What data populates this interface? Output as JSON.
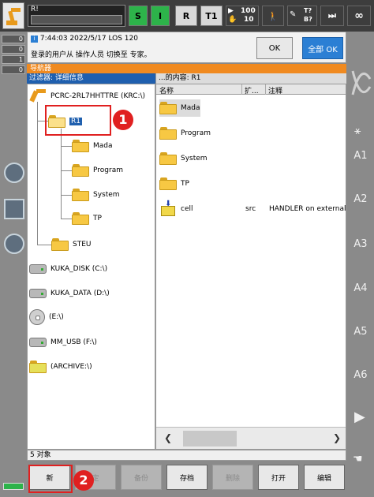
{
  "topbar": {
    "program_name": "R!",
    "status_s": "S",
    "status_i": "I",
    "status_r": "R",
    "mode": "T1",
    "override_top": "100",
    "override_bottom": "10",
    "tool_top": "T?",
    "tool_bottom": "B?",
    "infinity": "∞"
  },
  "leftstrip": {
    "counters": [
      "0",
      "0",
      "1",
      "0"
    ]
  },
  "message": {
    "line1": "7:44:03 2022/5/17 LOS 120",
    "line2": "登录的用户从 操作人员 切换至 专家。",
    "ok_label": "OK",
    "all_ok_label": "全部 OK"
  },
  "navigator": {
    "title": "导航器",
    "filter_label": "过滤器: 详细信息",
    "content_label": "...的内容: R1",
    "tree": {
      "root": "PCRC-2RL7HHTTRE (KRC:\\)",
      "r1": "R1",
      "children": [
        "Mada",
        "Program",
        "System",
        "TP"
      ],
      "steu": "STEU",
      "drives": [
        "KUKA_DISK (C:\\)",
        "KUKA_DATA (D:\\)",
        "(E:\\)",
        "MM_USB (F:\\)",
        "(ARCHIVE:\\)"
      ]
    },
    "list": {
      "headers": {
        "name": "名称",
        "ext": "扩...",
        "comment": "注释"
      },
      "items": [
        {
          "name": "Mada",
          "ext": "",
          "comment": ""
        },
        {
          "name": "Program",
          "ext": "",
          "comment": ""
        },
        {
          "name": "System",
          "ext": "",
          "comment": ""
        },
        {
          "name": "TP",
          "ext": "",
          "comment": ""
        },
        {
          "name": "cell",
          "ext": "src",
          "comment": "HANDLER on external ..."
        }
      ]
    },
    "status": "5 对象"
  },
  "softkeys": [
    "新",
    "定",
    "备份",
    "存档",
    "删除",
    "打开",
    "编辑"
  ],
  "rightstrip": {
    "axes": [
      "A1",
      "A2",
      "A3",
      "A4",
      "A5",
      "A6"
    ]
  },
  "annotations": {
    "one": "1",
    "two": "2"
  },
  "colors": {
    "accent_orange": "#f08a20",
    "selection_blue": "#1f5fae",
    "status_green": "#2db34a",
    "highlight_red": "#e02020"
  }
}
